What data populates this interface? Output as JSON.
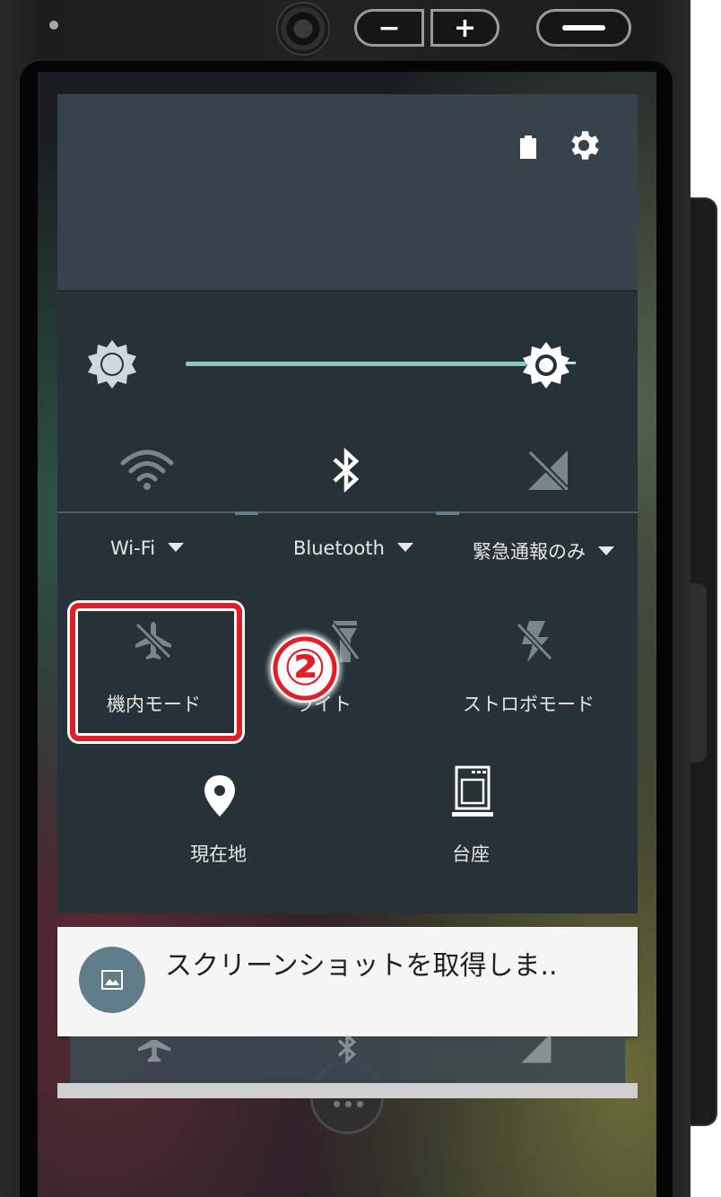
{
  "panel": {
    "tiles_row1": [
      {
        "label": "Wi-Fi",
        "icon": "wifi-icon"
      },
      {
        "label": "Bluetooth",
        "icon": "bluetooth-icon"
      },
      {
        "label": "緊急通報のみ",
        "icon": "no-signal-icon"
      }
    ],
    "tiles_row2": [
      {
        "label": "機内モード",
        "icon": "airplane-mode-icon"
      },
      {
        "label": "ライト",
        "icon": "flashlight-icon"
      },
      {
        "label": "ストロボモード",
        "icon": "strobe-icon"
      }
    ],
    "tiles_row3": [
      {
        "label": "現在地",
        "icon": "location-icon"
      },
      {
        "label": "台座",
        "icon": "dock-icon"
      }
    ],
    "brightness_level": 0.95
  },
  "annotation": {
    "step": "②"
  },
  "notification": {
    "title": "スクリーンショットを取得しま.."
  },
  "colors": {
    "panel_bg": "#263238",
    "header_bg": "#37424a",
    "slider_accent": "#80cbc4",
    "highlight": "#e01f26"
  }
}
